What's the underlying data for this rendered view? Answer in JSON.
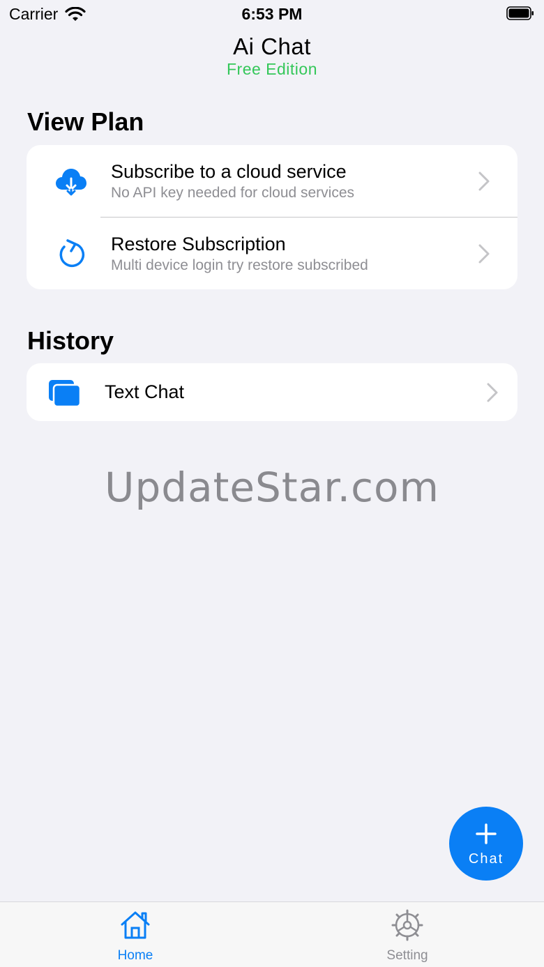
{
  "status_bar": {
    "carrier": "Carrier",
    "time": "6:53 PM"
  },
  "header": {
    "title": "Ai Chat",
    "subtitle": "Free Edition"
  },
  "view_plan": {
    "heading": "View Plan",
    "items": [
      {
        "title": "Subscribe to a cloud service",
        "subtitle": "No API key needed for cloud services",
        "icon": "cloud-download-icon"
      },
      {
        "title": "Restore Subscription",
        "subtitle": "Multi device login try restore subscribed",
        "icon": "refresh-icon"
      }
    ]
  },
  "history": {
    "heading": "History",
    "items": [
      {
        "title": "Text Chat",
        "icon": "chat-windows-icon"
      }
    ]
  },
  "watermark": "UpdateStar.com",
  "fab": {
    "label": "Chat"
  },
  "tab_bar": {
    "tabs": [
      {
        "label": "Home",
        "icon": "home-icon",
        "active": true
      },
      {
        "label": "Setting",
        "icon": "gear-icon",
        "active": false
      }
    ]
  },
  "colors": {
    "accent": "#0a7ff5",
    "free_edition": "#34c759",
    "background": "#f2f2f7",
    "secondary_text": "#8e8e93",
    "inactive_tab": "#8e8e93"
  }
}
